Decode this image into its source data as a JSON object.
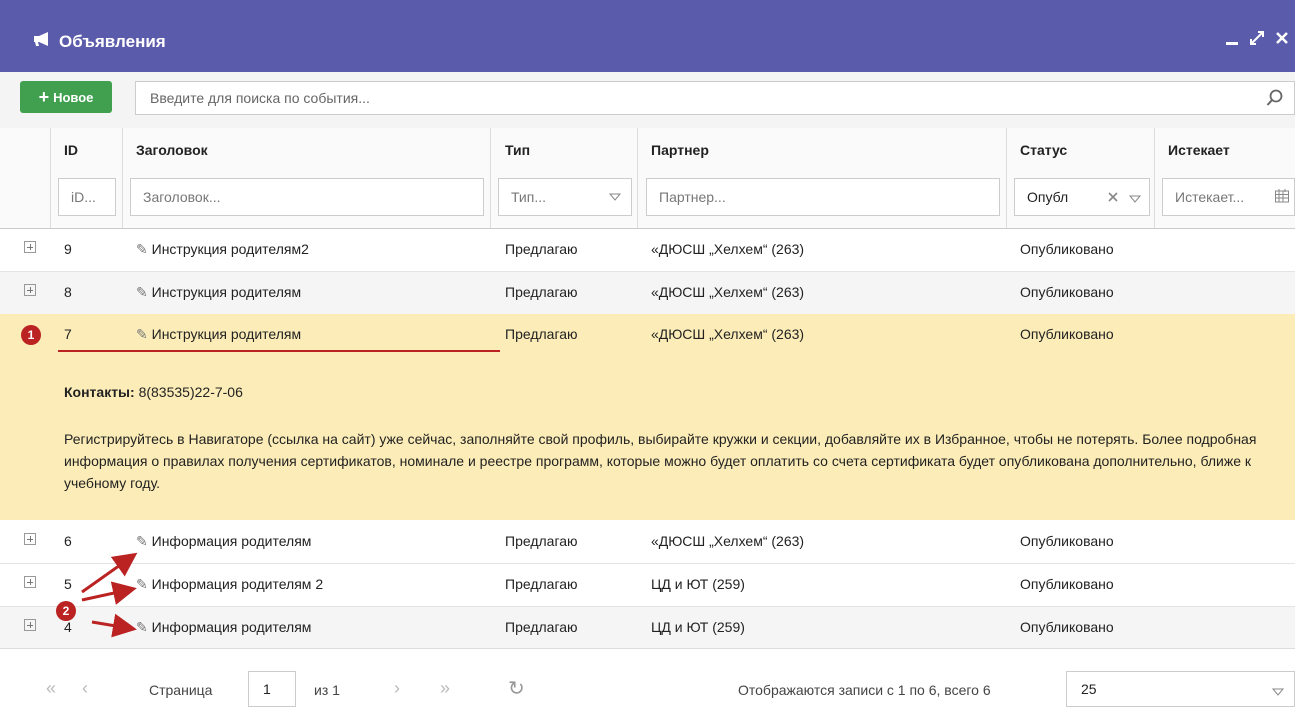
{
  "window": {
    "title": "Объявления"
  },
  "toolbar": {
    "new_label": "Новое",
    "search_placeholder": "Введите для поиска по события..."
  },
  "columns": {
    "id": "ID",
    "title": "Заголовок",
    "type": "Тип",
    "partner": "Партнер",
    "status": "Статус",
    "expires": "Истекает"
  },
  "filters": {
    "id": "iD...",
    "title": "Заголовок...",
    "type": "Тип...",
    "partner": "Партнер...",
    "status": "Опубл",
    "expires": "Истекает..."
  },
  "rows": [
    {
      "id": "9",
      "title": "Инструкция родителям2",
      "type": "Предлагаю",
      "partner": "«ДЮСШ „Хелхем“ (263)",
      "status": "Опубликовано"
    },
    {
      "id": "8",
      "title": "Инструкция родителям",
      "type": "Предлагаю",
      "partner": "«ДЮСШ „Хелхем“ (263)",
      "status": "Опубликовано"
    },
    {
      "id": "7",
      "title": "Инструкция родителям",
      "type": "Предлагаю",
      "partner": "«ДЮСШ „Хелхем“ (263)",
      "status": "Опубликовано"
    },
    {
      "id": "6",
      "title": "Информация родителям",
      "type": "Предлагаю",
      "partner": "«ДЮСШ „Хелхем“ (263)",
      "status": "Опубликовано"
    },
    {
      "id": "5",
      "title": "Информация родителям 2",
      "type": "Предлагаю",
      "partner": "ЦД и ЮТ (259)",
      "status": "Опубликовано"
    },
    {
      "id": "4",
      "title": "Информация родителям",
      "type": "Предлагаю",
      "partner": "ЦД и ЮТ (259)",
      "status": "Опубликовано"
    }
  ],
  "detail": {
    "contacts_label": "Контакты:",
    "contacts_value": " 8(83535)22-7-06",
    "text": "Регистрируйтесь в Навигаторе (ссылка на сайт) уже сейчас, заполняйте свой профиль, выбирайте кружки и секции, добавляйте их в Избранное, чтобы не потерять. Более подробная информация о правилах получения сертификатов, номинале и реестре программ, которые можно будет оплатить со счета сертификата будет опубликована дополнительно, ближе к учебному году."
  },
  "annotations": {
    "badge1": "1",
    "badge2": "2"
  },
  "pager": {
    "page_label": "Страница",
    "page_value": "1",
    "of_label": "из 1",
    "records_info": "Отображаются записи с 1 по 6, всего 6",
    "page_size": "25"
  },
  "colors": {
    "titlebar": "#5b5bab",
    "new_button": "#40a050",
    "highlight_row": "#fcedb8",
    "annotation": "#b22222"
  }
}
